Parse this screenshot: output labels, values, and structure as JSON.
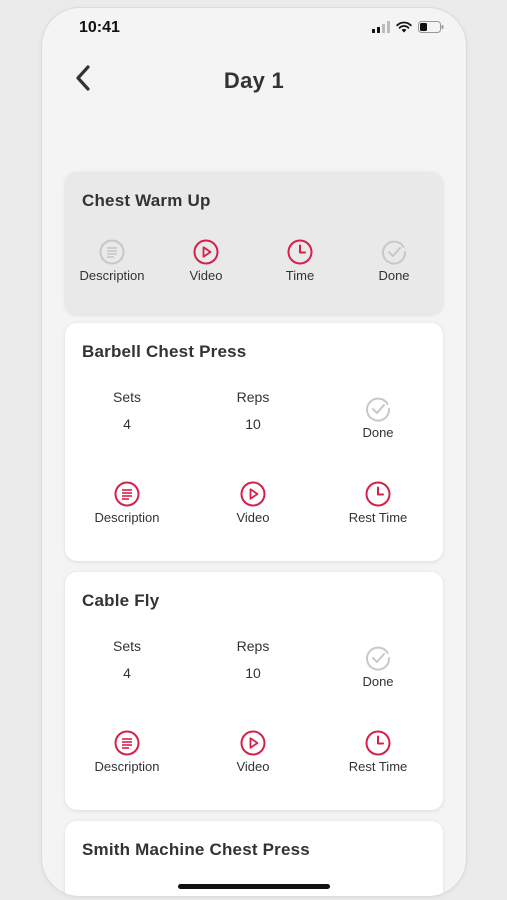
{
  "status_bar": {
    "time": "10:41"
  },
  "header": {
    "title": "Day 1"
  },
  "colors": {
    "accent": "#d6204a",
    "muted": "#c8c8c8",
    "card_inactive": "#e9e9e9"
  },
  "icons": {
    "back": "chevron-left-icon",
    "description": "document-icon",
    "video": "play-circle-icon",
    "time": "clock-icon",
    "done": "check-circle-icon"
  },
  "exercises": [
    {
      "title": "Chest Warm Up",
      "actions": {
        "description": "Description",
        "video": "Video",
        "time": "Time",
        "done": "Done"
      }
    },
    {
      "title": "Barbell Chest Press",
      "sets_label": "Sets",
      "sets": "4",
      "reps_label": "Reps",
      "reps": "10",
      "done": "Done",
      "actions": {
        "description": "Description",
        "video": "Video",
        "rest_time": "Rest Time"
      }
    },
    {
      "title": "Cable Fly",
      "sets_label": "Sets",
      "sets": "4",
      "reps_label": "Reps",
      "reps": "10",
      "done": "Done",
      "actions": {
        "description": "Description",
        "video": "Video",
        "rest_time": "Rest Time"
      }
    },
    {
      "title": "Smith Machine Chest Press"
    }
  ]
}
